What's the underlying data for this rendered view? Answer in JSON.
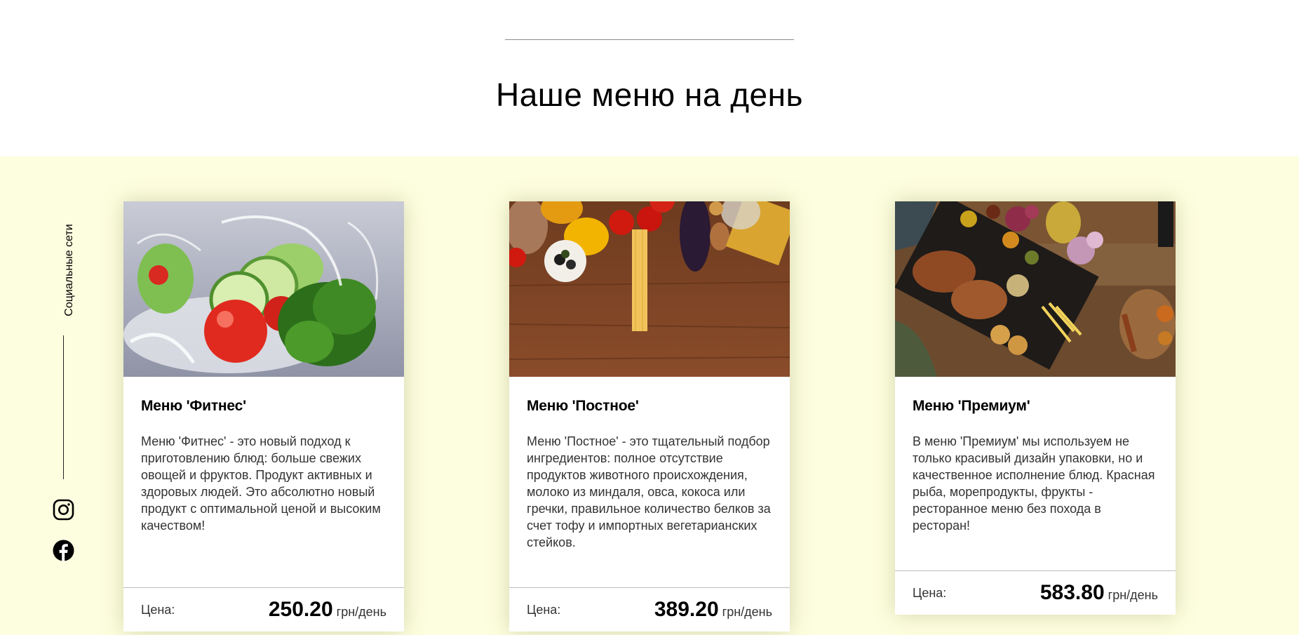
{
  "header": {
    "title": "Наше меню на день"
  },
  "social": {
    "label": "Социальные сети",
    "icons": [
      "instagram-icon",
      "facebook-icon"
    ]
  },
  "cards": [
    {
      "title": "Меню 'Фитнес'",
      "description": "Меню 'Фитнес' - это новый подход к приготовлению блюд: больше свежих овощей и фруктов. Продукт активных и здоровых людей. Это абсолютно новый продукт с оптимальной ценой и высоким качеством!",
      "price_label": "Цена:",
      "price": "250.20",
      "price_unit": "грн/день"
    },
    {
      "title": "Меню 'Постное'",
      "description": "Меню 'Постное' - это тщательный подбор ингредиентов: полное отсутствие продуктов животного происхождения, молоко из миндаля, овса, кокоса или гречки, правильное количество белков за счет тофу и импортных вегетарианских стейков.",
      "price_label": "Цена:",
      "price": "389.20",
      "price_unit": "грн/день"
    },
    {
      "title": "Меню 'Премиум'",
      "description": "В меню 'Премиум' мы используем не только красивый дизайн упаковки, но и качественное исполнение блюд. Красная рыба, морепродукты, фрукты - ресторанное меню без похода в ресторан!",
      "price_label": "Цена:",
      "price": "583.80",
      "price_unit": "грн/день"
    }
  ],
  "colors": {
    "section_bg": "#fdfedf",
    "card_bg": "#ffffff",
    "text": "#000000"
  }
}
